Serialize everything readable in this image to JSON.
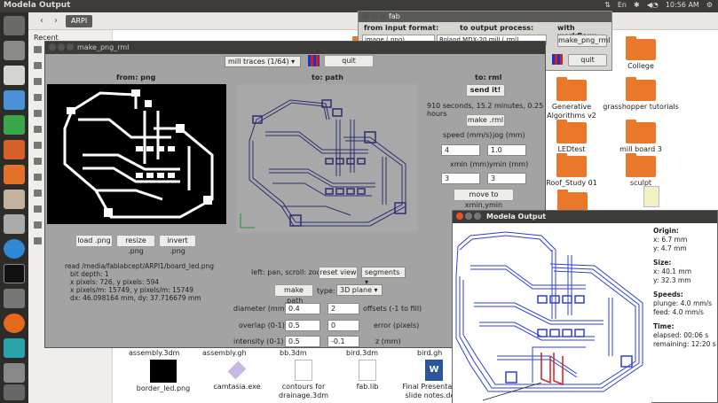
{
  "topbar": {
    "title": "Modela Output",
    "lang": "En",
    "volume": "◀◔",
    "time": "10:56 AM"
  },
  "filemanager": {
    "breadcrumb": "ARPI",
    "sidebar_recent": "Recent",
    "top_files": [
      {
        "label": "College",
        "kind": "folder"
      },
      {
        "label": "Generative Algorithms v2",
        "kind": "folder"
      },
      {
        "label": "grasshopper tutorials",
        "kind": "folder"
      },
      {
        "label": "LEDtest",
        "kind": "folder"
      },
      {
        "label": "mill board 3",
        "kind": "folder"
      },
      {
        "label": "Roof_Study 01",
        "kind": "folder"
      },
      {
        "label": "sculpt",
        "kind": "folder"
      }
    ],
    "bottom_row_labels": [
      "assembly.3dm",
      "assembly.gh",
      "bb.3dm",
      "bird.3dm",
      "bird.gh"
    ],
    "bottom_files": [
      {
        "label": "border_led.png"
      },
      {
        "label": "camtasia.exe"
      },
      {
        "label": "contours for drainage.3dm"
      },
      {
        "label": "fab.lib"
      },
      {
        "label": "Final Presentation slide notes.docx"
      }
    ]
  },
  "fab": {
    "title": "fab",
    "input_label": "from input format:",
    "input_value": "image (.png)",
    "process_label": "to output process:",
    "process_value": "Roland MDX-20 mill (.rml)",
    "workflow_label": "with workflow:",
    "workflow_button": "make_png_rml",
    "quit": "quit"
  },
  "mpr": {
    "title": "make_png_rml",
    "mode": "mill traces (1/64)",
    "quit": "quit",
    "col_png": "from: png",
    "col_path": "to: path",
    "col_rml": "to: rml",
    "load_png": "load .png",
    "resize_png": "resize .png",
    "invert_png": "invert .png",
    "info_lines": [
      "read /media/fablabcept/ARPI1/board_led.png",
      "bit depth: 1",
      "x pixels: 726, y pixels: 594",
      "x pixels/m: 15749, y pixels/m: 15749",
      "dx: 46.098164 mm, dy: 37.716679 mm"
    ],
    "pan_hint": "left: pan, scroll: zoom",
    "reset_view": "reset view",
    "view_mode": "segments",
    "make_path": "make .path",
    "type_label": "type:",
    "type_value": "3D plane",
    "diameter_label": "diameter (mm)",
    "diameter": "0.4",
    "offsets": "2",
    "offsets_label": "offsets (-1 to fill)",
    "overlap_label": "overlap (0-1)",
    "overlap": "0.5",
    "error": "0",
    "error_label": "error (pixels)",
    "intensity_label": "intensity (0-1)",
    "intensity": "0.5",
    "z": "-0.1",
    "z_label": "z (mm)",
    "send": "send it!",
    "time_estimate": "910 seconds, 15.2 minutes, 0.25 hours",
    "make_rml": "make .rml",
    "speed_label": "speed (mm/s)",
    "jog_label": "jog (mm)",
    "speed": "4",
    "jog": "1.0",
    "xmin_label": "xmin (mm)",
    "ymin_label": "ymin (mm)",
    "xmin": "3",
    "ymin": "3",
    "move_button": "move to xmin,ymin"
  },
  "modela": {
    "title": "Modela Output",
    "origin_h": "Origin:",
    "origin_x": "x: 6.7 mm",
    "origin_y": "y: 4.7 mm",
    "size_h": "Size:",
    "size_x": "x: 40.1 mm",
    "size_y": "y: 32.3 mm",
    "speeds_h": "Speeds:",
    "plunge": "plunge: 4.0 mm/s",
    "feed": "feed: 4.0 mm/s",
    "time_h": "Time:",
    "elapsed": "elapsed: 00:06 s",
    "remaining": "remaining: 12:20 s"
  },
  "colors": {
    "orange": "#e9782a",
    "panel": "#3c3b37",
    "toolpath": "#2f3fd8",
    "path_lines": "#2a2f6e",
    "cut": "#d02020"
  }
}
